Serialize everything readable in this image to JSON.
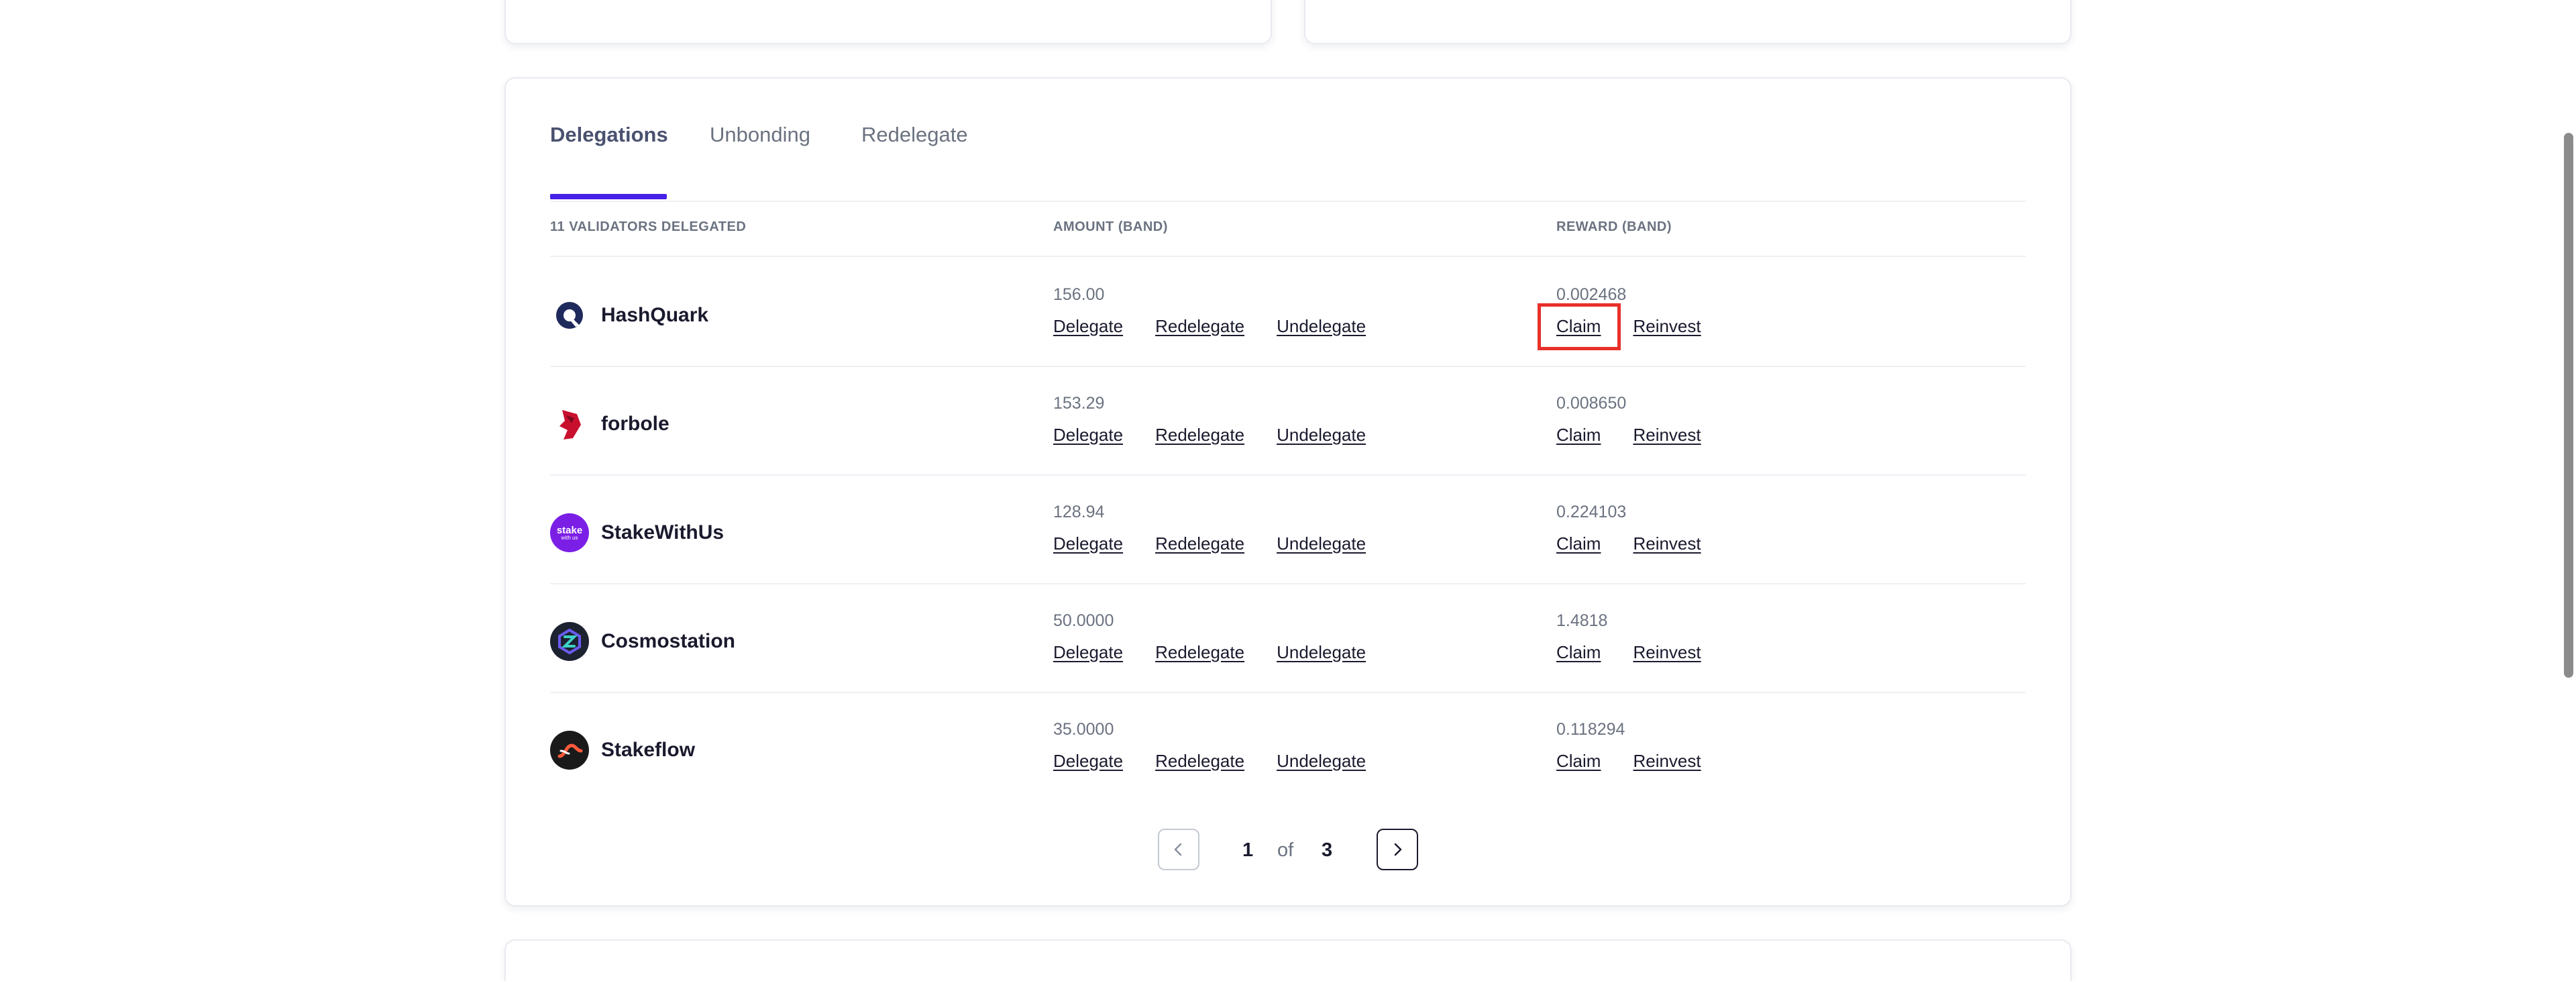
{
  "tabs": [
    {
      "label": "Delegations"
    },
    {
      "label": "Unbonding"
    },
    {
      "label": "Redelegate"
    }
  ],
  "table": {
    "headers": {
      "validator": "11 VALIDATORS DELEGATED",
      "amount": "AMOUNT (BAND)",
      "reward": "REWARD (BAND)"
    },
    "rows": [
      {
        "name": "HashQuark",
        "amount": "156.00",
        "reward": "0.002468"
      },
      {
        "name": "forbole",
        "amount": "153.29",
        "reward": "0.008650"
      },
      {
        "name": "StakeWithUs",
        "amount": "128.94",
        "reward": "0.224103"
      },
      {
        "name": "Cosmostation",
        "amount": "50.0000",
        "reward": "1.4818"
      },
      {
        "name": "Stakeflow",
        "amount": "35.0000",
        "reward": "0.118294"
      }
    ]
  },
  "actions": {
    "delegate": "Delegate",
    "redelegate": "Redelegate",
    "undelegate": "Undelegate",
    "claim": "Claim",
    "reinvest": "Reinvest"
  },
  "avatar_text": {
    "stakewithus_line1": "stake",
    "stakewithus_line2": "with us"
  },
  "pagination": {
    "current": "1",
    "of": "of",
    "total": "3"
  },
  "colors": {
    "accent": "#4520e6",
    "highlight": "#e8302a"
  }
}
